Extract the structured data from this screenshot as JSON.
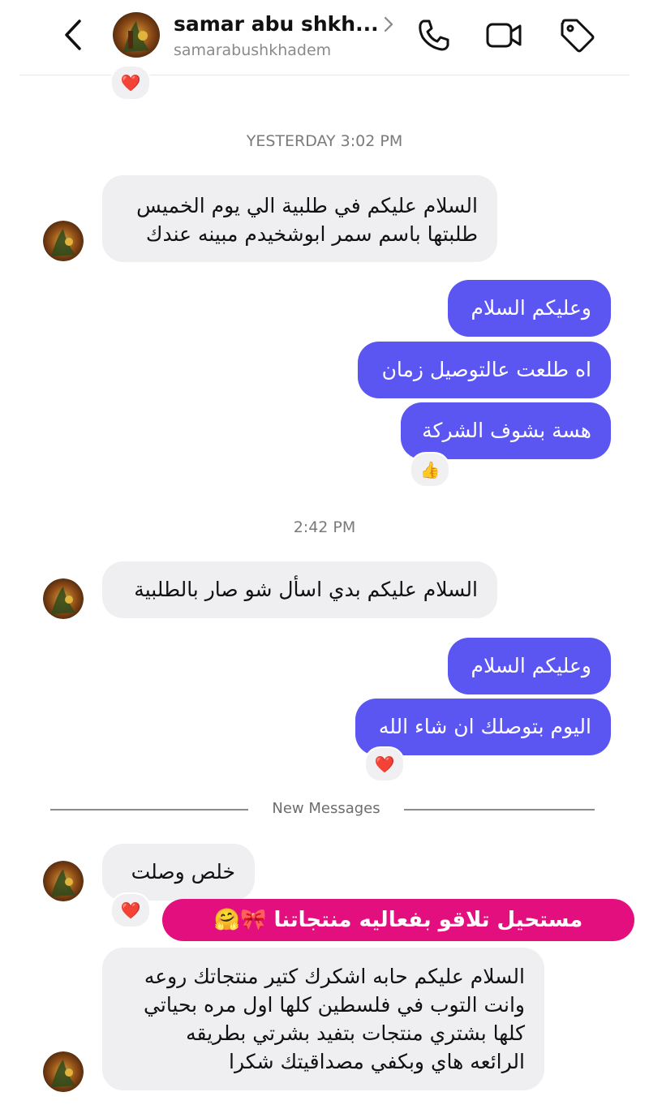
{
  "header": {
    "name": "samar abu shkh...",
    "username": "samarabushkhadem",
    "icons": {
      "back": "chevron-left-icon",
      "call": "phone-icon",
      "video": "video-camera-icon",
      "tag": "tag-icon"
    }
  },
  "timestamps": {
    "first": "YESTERDAY 3:02 PM",
    "second": "2:42 PM"
  },
  "messages": {
    "m1": {
      "line1": "السلام عليكم في طلبية الي يوم الخميس",
      "line2": "طلبتها باسم سمر ابوشخيدم مبينه عندك"
    },
    "m2": "وعليكم السلام",
    "m3": "اه طلعت عالتوصيل زمان",
    "m4": "هسة بشوف الشركة",
    "m5": "السلام عليكم بدي اسأل شو صار بالطلبية",
    "m6": "وعليكم السلام",
    "m7": "اليوم بتوصلك ان شاء الله",
    "m8": "خلص وصلت",
    "m9": {
      "line1": "السلام عليكم حابه اشكرك كتير منتجاتك روعه",
      "line2": "وانت التوب في فلسطين كلها اول مره بحياتي",
      "line3": "كلها بشتري منتجات بتفيد بشرتي بطريقه",
      "line4": "الرائعه هاي وبكفي مصداقيتك شكرا"
    }
  },
  "reactions": {
    "top": "❤️",
    "m4": "👍",
    "m7": "❤️",
    "m8": "❤️"
  },
  "divider": {
    "label": "New Messages"
  },
  "banner": {
    "text": "مستحيل تلاقو بفعاليه منتجاتنا 🎀🤗"
  },
  "colors": {
    "outgoing": "#5b55f2",
    "incoming": "#efeff2",
    "banner": "#e30f7e"
  }
}
